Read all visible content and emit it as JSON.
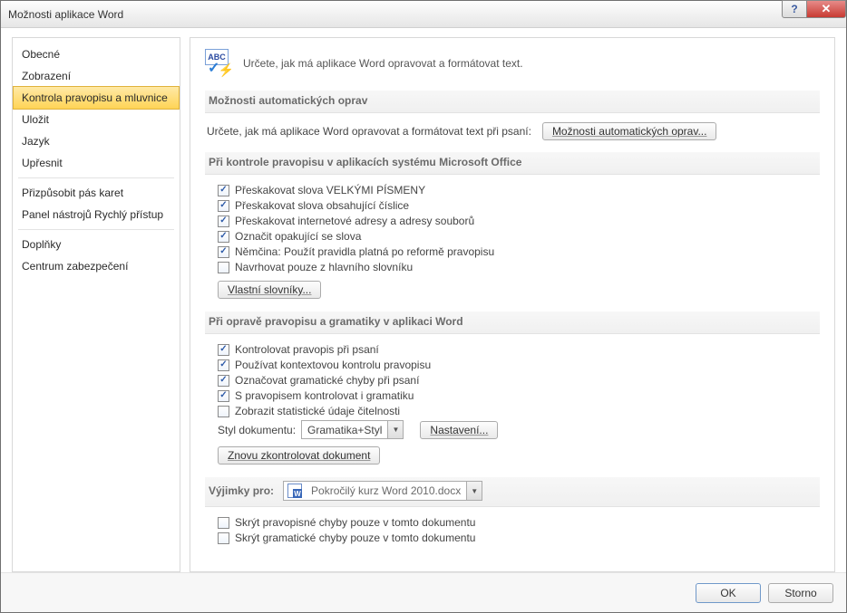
{
  "title": "Možnosti aplikace Word",
  "sidebar": {
    "items": [
      "Obecné",
      "Zobrazení",
      "Kontrola pravopisu a mluvnice",
      "Uložit",
      "Jazyk",
      "Upřesnit",
      "Přizpůsobit pás karet",
      "Panel nástrojů Rychlý přístup",
      "Doplňky",
      "Centrum zabezpečení"
    ],
    "active_index": 2,
    "separators_after": [
      5,
      7
    ]
  },
  "header": {
    "text": "Určete, jak má aplikace Word opravovat a formátovat text.",
    "abc": "ABC"
  },
  "section1": {
    "title": "Možnosti automatických oprav",
    "desc": "Určete, jak má aplikace Word opravovat a formátovat text při psaní:",
    "button": "Možnosti automatických oprav..."
  },
  "section2": {
    "title": "Při kontrole pravopisu v aplikacích systému Microsoft Office",
    "checks": [
      {
        "label": "Přeskakovat slova VELKÝMI PÍSMENY",
        "checked": true
      },
      {
        "label": "Přeskakovat slova obsahující číslice",
        "checked": true
      },
      {
        "label": "Přeskakovat internetové adresy a adresy souborů",
        "checked": true
      },
      {
        "label": "Označit opakující se slova",
        "checked": true
      },
      {
        "label": "Němčina: Použít pravidla platná po reformě pravopisu",
        "checked": true
      },
      {
        "label": "Navrhovat pouze z hlavního slovníku",
        "checked": false
      }
    ],
    "button": "Vlastní slovníky..."
  },
  "section3": {
    "title": "Při opravě pravopisu a gramatiky v aplikaci Word",
    "checks": [
      {
        "label": "Kontrolovat pravopis při psaní",
        "checked": true
      },
      {
        "label": "Používat kontextovou kontrolu pravopisu",
        "checked": true
      },
      {
        "label": "Označovat gramatické chyby při psaní",
        "checked": true
      },
      {
        "label": "S pravopisem kontrolovat i gramatiku",
        "checked": true
      },
      {
        "label": "Zobrazit statistické údaje čitelnosti",
        "checked": false
      }
    ],
    "style_label": "Styl dokumentu:",
    "style_value": "Gramatika+Styl",
    "settings_button": "Nastavení...",
    "recheck_button": "Znovu zkontrolovat dokument"
  },
  "section4": {
    "title": "Výjimky pro:",
    "doc": "Pokročilý kurz Word 2010.docx",
    "checks": [
      {
        "label": "Skrýt pravopisné chyby pouze v tomto dokumentu",
        "checked": false
      },
      {
        "label": "Skrýt gramatické chyby pouze v tomto dokumentu",
        "checked": false
      }
    ]
  },
  "footer": {
    "ok": "OK",
    "cancel": "Storno"
  }
}
